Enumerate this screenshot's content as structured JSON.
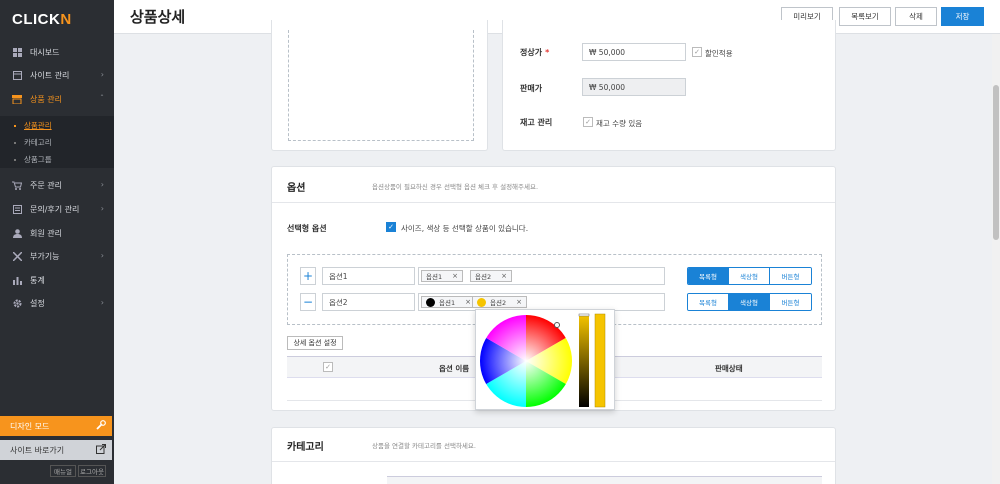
{
  "sidebar": {
    "logo_main": "CLICK",
    "logo_accent": "N",
    "items": [
      {
        "label": "대시보드",
        "icon": "dashboard-icon"
      },
      {
        "label": "사이트 관리",
        "icon": "site-icon"
      },
      {
        "label": "상품 관리",
        "icon": "store-icon"
      },
      {
        "label": "주문 관리",
        "icon": "cart-icon"
      },
      {
        "label": "문의/후기 관리",
        "icon": "inquiry-icon"
      },
      {
        "label": "회원 관리",
        "icon": "user-icon"
      },
      {
        "label": "부가기능",
        "icon": "addon-icon"
      },
      {
        "label": "통계",
        "icon": "stats-icon"
      },
      {
        "label": "설정",
        "icon": "gear-icon"
      }
    ],
    "sub_items": [
      "상품관리",
      "카테고리",
      "상품그룹"
    ],
    "design_mode": "디자인 모드",
    "go_site": "사이트 바로가기",
    "manual": "매뉴얼",
    "logout": "로그아웃"
  },
  "header": {
    "title": "상품상세",
    "buttons": [
      "미리보기",
      "목록보기",
      "삭제",
      "저장"
    ]
  },
  "price": {
    "regular_label": "정상가",
    "regular_value": "₩  50,000",
    "discount_label": "할인적용",
    "sale_label": "판매가",
    "sale_value": "₩  50,000",
    "stock_label": "재고 관리",
    "stock_check_label": "재고 수량 있음"
  },
  "options": {
    "title": "옵션",
    "desc": "옵션상품이 필요하신 경우 선택형 옵션 체크 후 설정해주세요.",
    "select_label": "선택형 옵션",
    "select_check_label": "사이즈, 색상 등 선택할 상품이 있습니다.",
    "rows": [
      {
        "name": "옵션1",
        "tags": [
          {
            "label": "옵션1"
          },
          {
            "label": "옵션2"
          }
        ],
        "selected": 0
      },
      {
        "name": "옵션2",
        "tags": [
          {
            "label": "옵션1",
            "color": "#000000"
          },
          {
            "label": "옵션2",
            "color": "#f5c400"
          }
        ],
        "selected": 1
      }
    ],
    "types": [
      "목록형",
      "색상형",
      "버튼형"
    ],
    "detail_button": "상세 옵션 설정",
    "col_name": "옵션 이름",
    "col_status": "판매상태"
  },
  "category": {
    "title": "카테고리",
    "desc": "상품을 연결할 카테고리를 선택하세요."
  },
  "picker": {
    "selected_color": "#f5c400"
  }
}
